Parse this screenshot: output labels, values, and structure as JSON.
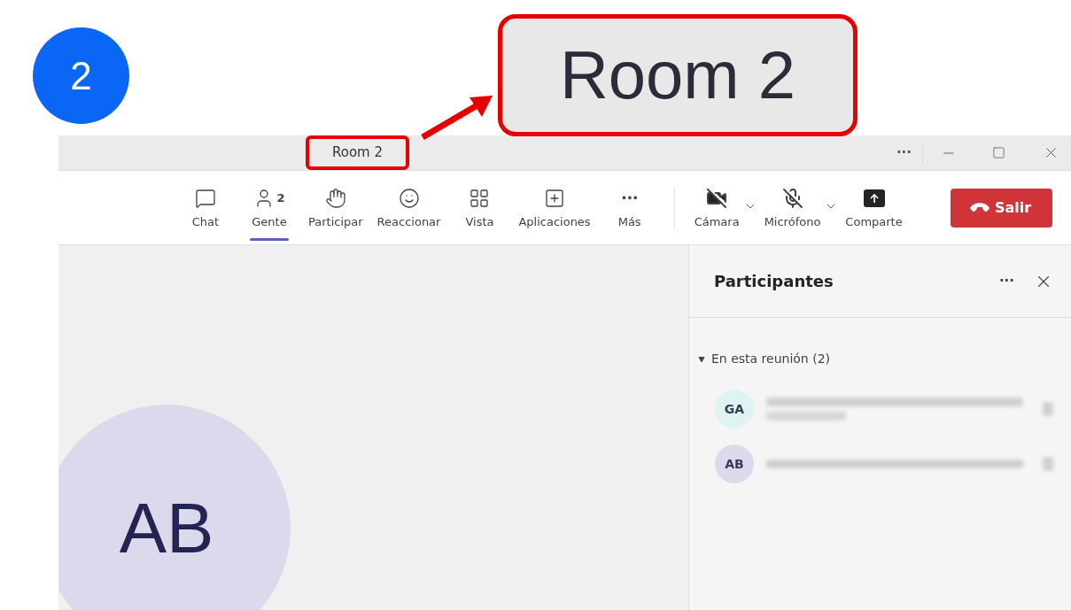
{
  "step_badge": "2",
  "callout": {
    "text": "Room 2"
  },
  "window": {
    "title": "Room 2",
    "controls": [
      "···"
    ]
  },
  "toolbar": [
    {
      "kind": "chat",
      "label": "Chat",
      "selected": false
    },
    {
      "kind": "people",
      "label": "Gente",
      "count": "2",
      "selected": true
    },
    {
      "kind": "hand",
      "label": "Participar",
      "selected": false
    },
    {
      "kind": "react",
      "label": "Reaccionar",
      "selected": false
    },
    {
      "kind": "view",
      "label": "Vista",
      "selected": false
    },
    {
      "kind": "apps",
      "label": "Aplicaciones",
      "selected": false
    },
    {
      "kind": "more",
      "label": "Más",
      "glyph": "···",
      "selected": false
    }
  ],
  "media": [
    {
      "kind": "camera",
      "label": "Cámara",
      "muted": true
    },
    {
      "kind": "mic",
      "label": "Micrófono",
      "muted": true
    },
    {
      "kind": "share",
      "label": "Comparte"
    }
  ],
  "leave_button": "Salir",
  "panel": {
    "title": "Participantes",
    "more": "···",
    "section": {
      "label": "En esta reunión (2)",
      "expanded": true
    },
    "participants": [
      {
        "initials": "GA",
        "color": "#dff3f3",
        "two_lines": true
      },
      {
        "initials": "AB",
        "color": "#dcd9ec",
        "two_lines": false
      }
    ]
  },
  "stage": {
    "avatar": "AB"
  }
}
